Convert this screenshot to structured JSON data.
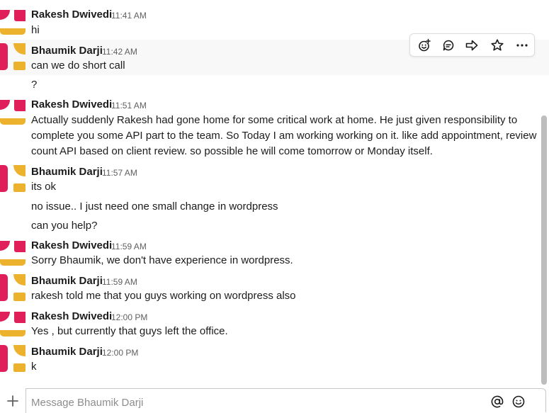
{
  "messages": [
    {
      "sender": "Rakesh Dwivedi",
      "time": "11:41 AM",
      "lines": [
        "hi"
      ]
    },
    {
      "sender": "Bhaumik Darji",
      "time": "11:42 AM",
      "lines": [
        "can we do short call",
        "?"
      ]
    },
    {
      "sender": "Rakesh Dwivedi",
      "time": "11:51 AM",
      "lines": [
        "Actually suddenly Rakesh had gone home for some critical work at home. He just given responsibility to complete you some API part to the team. So Today I am working working on it. like add appointment, review count API based on client review. so possible he will come tomorrow or Monday itself."
      ]
    },
    {
      "sender": "Bhaumik Darji",
      "time": "11:57 AM",
      "lines": [
        "its ok",
        "no issue.. I just need one small change in wordpress",
        "can you help?"
      ]
    },
    {
      "sender": "Rakesh Dwivedi",
      "time": "11:59 AM",
      "lines": [
        "Sorry Bhaumik, we don't have experience in wordpress."
      ]
    },
    {
      "sender": "Bhaumik Darji",
      "time": "11:59 AM",
      "lines": [
        "rakesh told me that you guys working on wordpress also"
      ]
    },
    {
      "sender": "Rakesh Dwivedi",
      "time": "12:00 PM",
      "lines": [
        "Yes , but currently that guys left the office."
      ]
    },
    {
      "sender": "Bhaumik Darji",
      "time": "12:00 PM",
      "lines": [
        "k"
      ]
    }
  ],
  "toolbar": {
    "icons": [
      "add-reaction-icon",
      "reply-thread-icon",
      "share-message-icon",
      "save-star-icon",
      "more-actions-icon"
    ]
  },
  "composer": {
    "placeholder": "Message Bhaumik Darji",
    "value": "",
    "icons": [
      "plus-icon",
      "mention-at-icon",
      "emoji-icon"
    ]
  }
}
